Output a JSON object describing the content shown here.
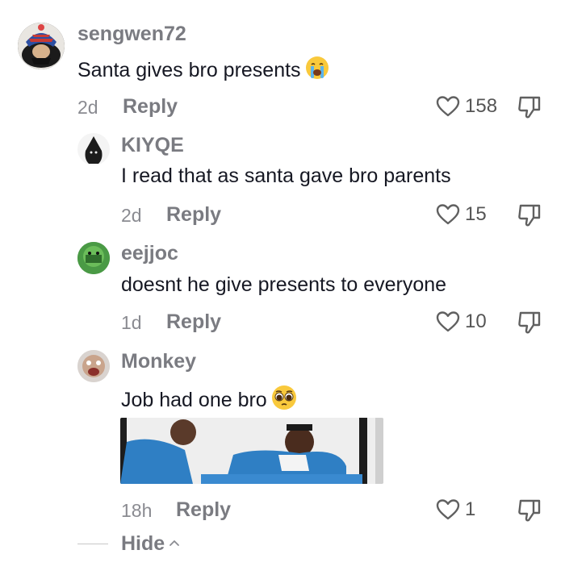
{
  "comments": [
    {
      "username": "sengwen72",
      "text": "Santa gives bro presents",
      "emoji": "crying-face",
      "time": "2d",
      "reply_label": "Reply",
      "likes": "158"
    },
    {
      "username": "KIYQE",
      "text": "I read that as santa gave bro parents",
      "time": "2d",
      "reply_label": "Reply",
      "likes": "15"
    },
    {
      "username": "eejjoc",
      "text": "doesnt he give presents to everyone",
      "time": "1d",
      "reply_label": "Reply",
      "likes": "10"
    },
    {
      "username": "Monkey",
      "text": "Job had one bro",
      "emoji": "pleading-face",
      "time": "18h",
      "reply_label": "Reply",
      "likes": "1"
    }
  ],
  "hide_label": "Hide",
  "colors": {
    "username": "#7a7b81",
    "text": "#161823",
    "meta": "#8a8b91",
    "scrub_blue": "#2f7fc4"
  }
}
